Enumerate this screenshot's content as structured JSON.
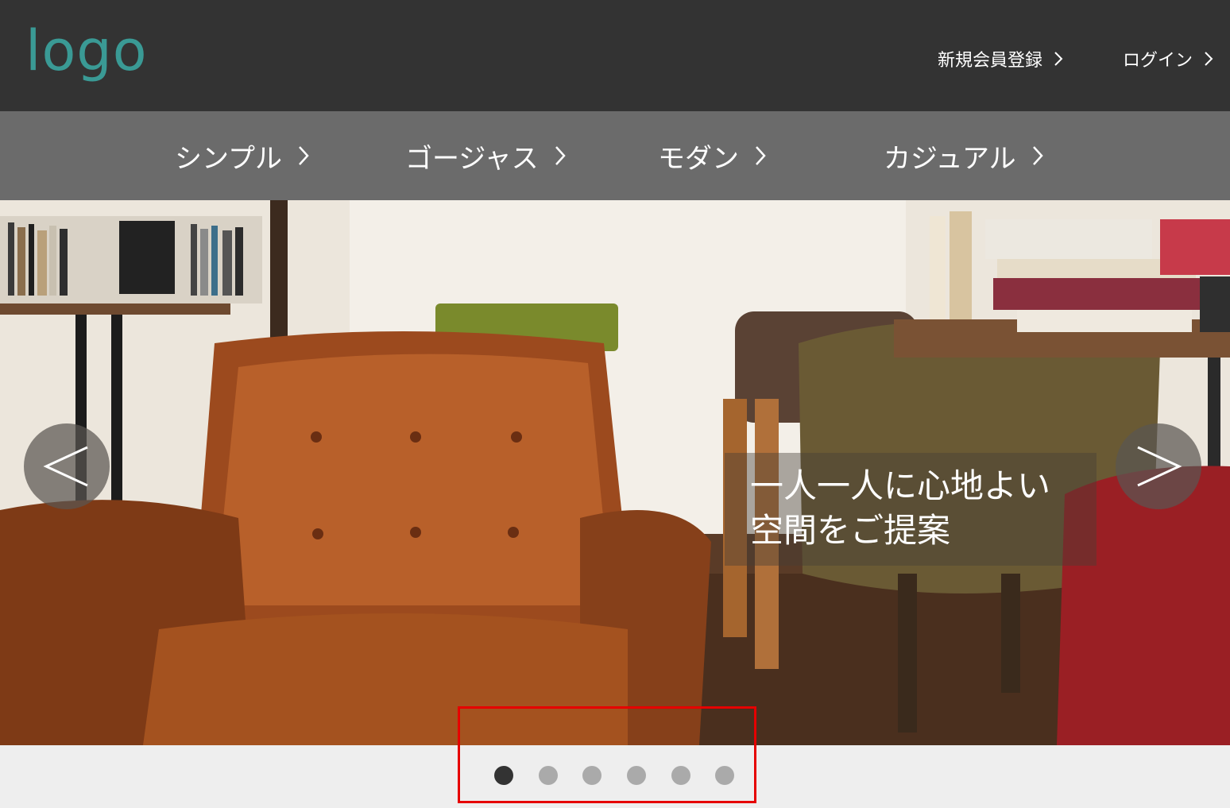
{
  "header": {
    "logo_text": "logo",
    "signup_label": "新規会員登録",
    "login_label": "ログイン"
  },
  "nav": {
    "items": [
      {
        "label": "シンプル"
      },
      {
        "label": "ゴージャス"
      },
      {
        "label": "モダン"
      },
      {
        "label": "カジュアル"
      }
    ]
  },
  "hero": {
    "caption": "一人一人に心地よい\n空間をご提案",
    "prev_icon": "chevron-left-icon",
    "next_icon": "chevron-right-icon"
  },
  "slider": {
    "slide_count": 6,
    "active_index": 0
  },
  "colors": {
    "header_bg": "#333333",
    "nav_bg": "#6b6b6b",
    "logo": "#3a9a95",
    "dot_active": "#333333",
    "dot_inactive": "#aaaaaa",
    "highlight": "#e60000"
  }
}
